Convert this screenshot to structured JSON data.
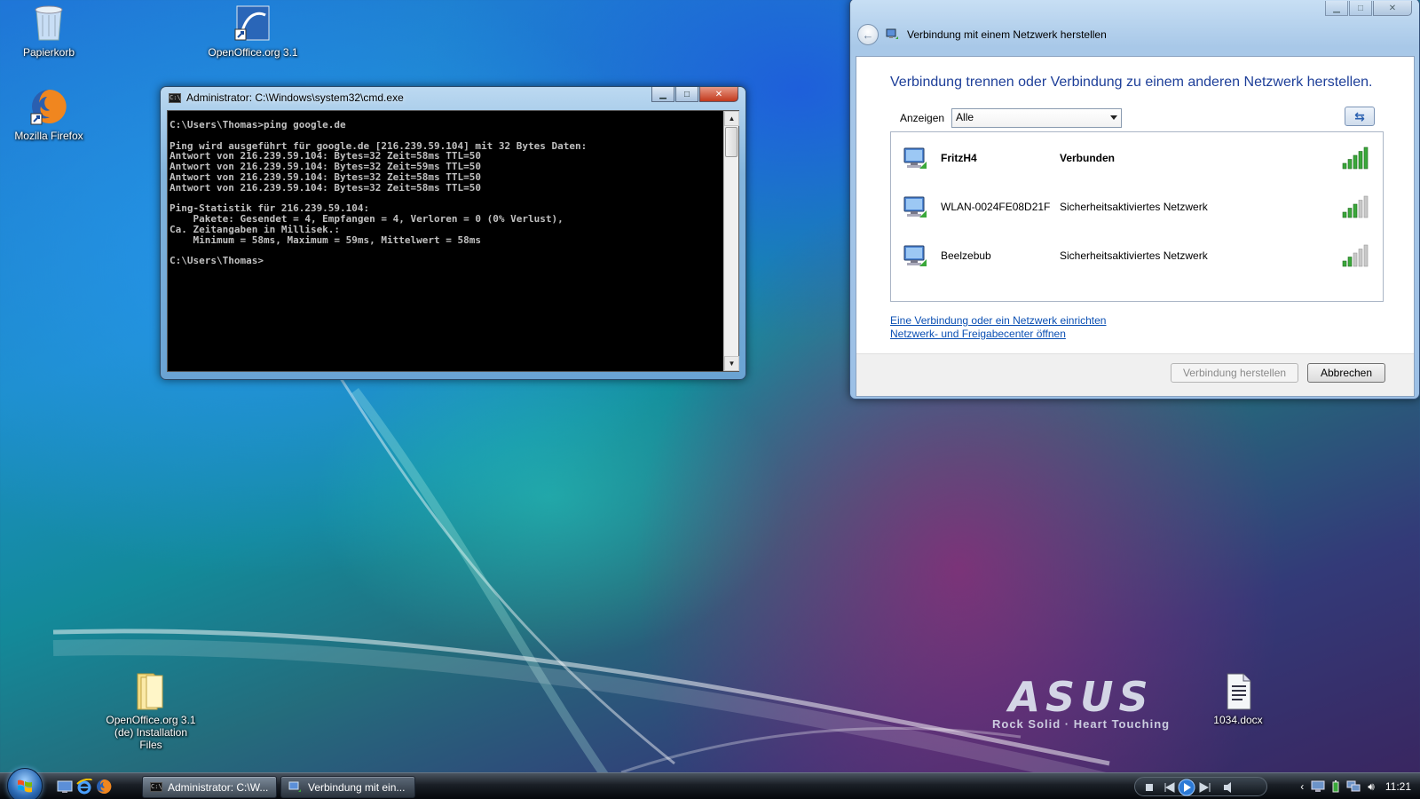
{
  "desktop": {
    "icons": {
      "recycle": "Papierkorb",
      "openoffice": "OpenOffice.org 3.1",
      "firefox": "Mozilla Firefox",
      "oo_install_line1": "OpenOffice.org 3.1",
      "oo_install_line2": "(de) Installation Files",
      "docx": "1034.docx"
    },
    "brand": {
      "logo": "ASUS",
      "tagline": "Rock Solid · Heart Touching"
    }
  },
  "cmd_window": {
    "title": "Administrator: C:\\Windows\\system32\\cmd.exe",
    "icon": "cmd-icon",
    "lines": [
      "C:\\Users\\Thomas>ping google.de",
      "",
      "Ping wird ausgeführt für google.de [216.239.59.104] mit 32 Bytes Daten:",
      "Antwort von 216.239.59.104: Bytes=32 Zeit=58ms TTL=50",
      "Antwort von 216.239.59.104: Bytes=32 Zeit=59ms TTL=50",
      "Antwort von 216.239.59.104: Bytes=32 Zeit=58ms TTL=50",
      "Antwort von 216.239.59.104: Bytes=32 Zeit=58ms TTL=50",
      "",
      "Ping-Statistik für 216.239.59.104:",
      "    Pakete: Gesendet = 4, Empfangen = 4, Verloren = 0 (0% Verlust),",
      "Ca. Zeitangaben in Millisek.:",
      "    Minimum = 58ms, Maximum = 59ms, Mittelwert = 58ms",
      "",
      "C:\\Users\\Thomas>"
    ]
  },
  "network_dialog": {
    "title": "Verbindung mit einem Netzwerk herstellen",
    "heading": "Verbindung trennen oder Verbindung zu einem anderen Netzwerk herstellen.",
    "filter_label": "Anzeigen",
    "filter_value": "Alle",
    "networks": [
      {
        "name": "FritzH4",
        "status": "Verbunden",
        "bold": true,
        "signal_bars": 5
      },
      {
        "name": "WLAN-0024FE08D21F",
        "status": "Sicherheitsaktiviertes Netzwerk",
        "bold": false,
        "signal_bars": 3
      },
      {
        "name": "Beelzebub",
        "status": "Sicherheitsaktiviertes Netzwerk",
        "bold": false,
        "signal_bars": 2
      }
    ],
    "links": {
      "setup": "Eine Verbindung oder ein Netzwerk einrichten",
      "center": "Netzwerk- und Freigabecenter öffnen"
    },
    "buttons": {
      "connect": "Verbindung herstellen",
      "cancel": "Abbrechen"
    }
  },
  "taskbar": {
    "tasks": [
      {
        "label": "Administrator: C:\\W...",
        "icon": "cmd-icon"
      },
      {
        "label": "Verbindung mit ein...",
        "icon": "network-icon"
      }
    ],
    "clock": "11:21"
  },
  "colors": {
    "heading_blue": "#1e3f99",
    "link_blue": "#0a4fb3",
    "signal_green": "#3aa83a",
    "console_text": "#c0c0c0"
  }
}
